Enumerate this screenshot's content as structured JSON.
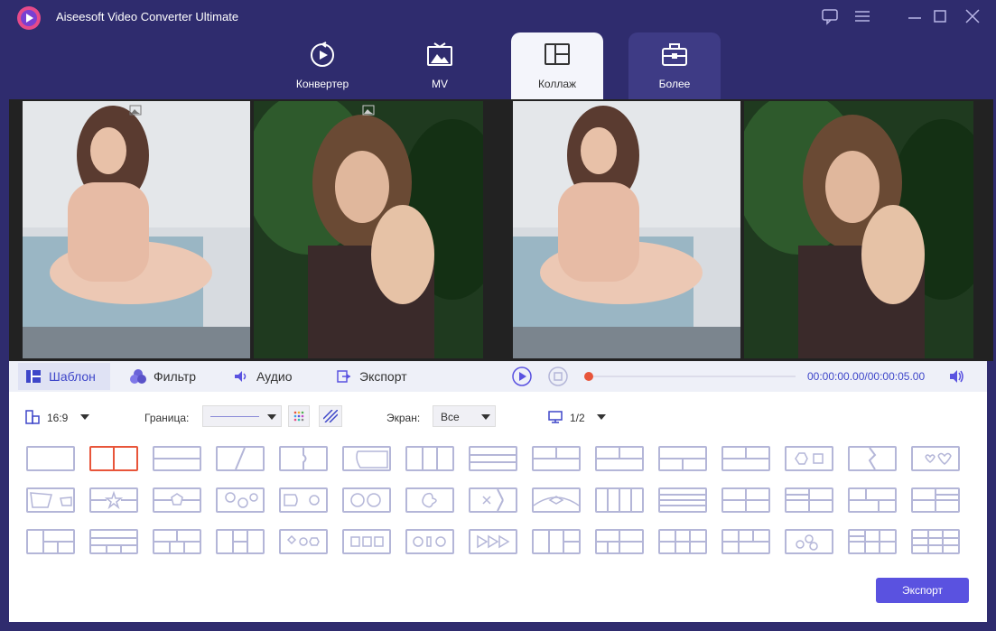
{
  "app": {
    "title": "Aiseesoft Video Converter Ultimate"
  },
  "tabs": [
    {
      "label": "Конвертер",
      "icon": "convert-icon"
    },
    {
      "label": "MV",
      "icon": "mv-icon"
    },
    {
      "label": "Коллаж",
      "icon": "collage-icon",
      "active": true
    },
    {
      "label": "Более",
      "icon": "toolbox-icon"
    }
  ],
  "toolbar": {
    "template": "Шаблон",
    "filter": "Фильтр",
    "audio": "Аудио",
    "export": "Экспорт"
  },
  "player": {
    "time": "00:00:00.00/00:00:05.00",
    "progress": 0
  },
  "options": {
    "aspect": "16:9",
    "border_label": "Граница:",
    "screen_label": "Экран:",
    "screen_value": "Все",
    "page": "1/2"
  },
  "templates": {
    "count": 45,
    "selected_index": 1
  },
  "export_button": "Экспорт",
  "colors": {
    "accent": "#5a52e0",
    "selected": "#e8553a",
    "titlebar": "#2f2c6e"
  }
}
